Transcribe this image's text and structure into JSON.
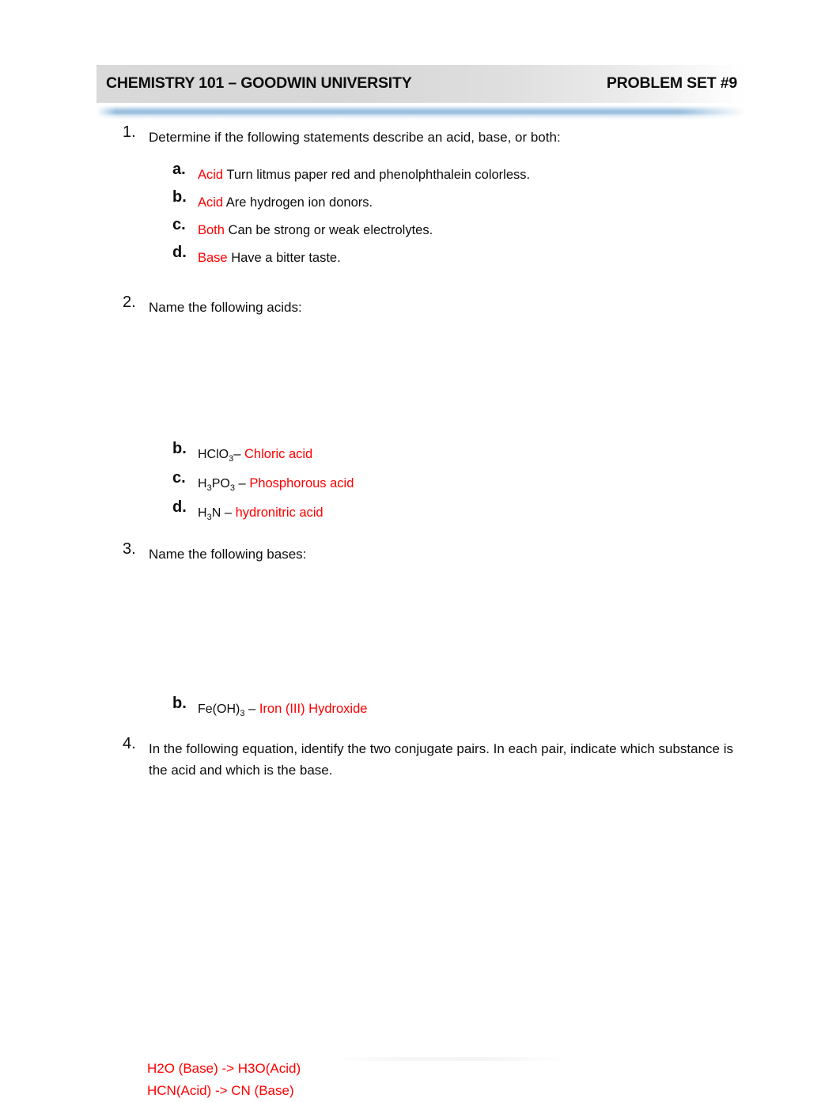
{
  "header": {
    "title_left": "CHEMISTRY 101 – GOODWIN UNIVERSITY",
    "title_right": "PROBLEM SET #9",
    "accent_color": "#9cc0de",
    "answer_color": "#ff0000"
  },
  "questions": [
    {
      "number": "1.",
      "prompt": "Determine if the following statements describe an acid, base, or both:",
      "items": [
        {
          "letter": "a.",
          "answer": "Acid",
          "text": "Turn litmus paper red and phenolphthalein colorless."
        },
        {
          "letter": "b.",
          "answer": "Acid",
          "text": "Are hydrogen ion donors."
        },
        {
          "letter": "c.",
          "answer": "Both",
          "text": "Can be strong or weak electrolytes."
        },
        {
          "letter": "d.",
          "answer": "Base",
          "text": "Have a bitter taste."
        }
      ]
    },
    {
      "number": "2.",
      "prompt": "Name the following acids:",
      "items": [
        {
          "letter": "b.",
          "formula_main": "HClO",
          "formula_sub": "3",
          "formula_tail": "",
          "dash": "–",
          "answer": "Chloric acid"
        },
        {
          "letter": "c.",
          "formula_main": "H",
          "formula_sub": "3",
          "formula_tail": "PO",
          "formula_sub2": "3",
          "dash": "–",
          "answer": "Phosphorous acid"
        },
        {
          "letter": "d.",
          "formula_main": "H",
          "formula_sub": "3",
          "formula_tail": "N",
          "dash": "–",
          "answer": "hydronitric acid"
        }
      ]
    },
    {
      "number": "3.",
      "prompt": "Name the following bases:",
      "items": [
        {
          "letter": "b.",
          "formula_main": "Fe(OH)",
          "formula_sub": "3",
          "formula_tail": "",
          "dash": "–",
          "answer": "Iron (III) Hydroxide"
        }
      ]
    },
    {
      "number": "4.",
      "prompt": "In the following equation, identify the two conjugate pairs.  In each pair, indicate which substance is the acid and which is the base.",
      "items": []
    }
  ],
  "bottom_answers": [
    "H2O (Base) -> H3O(Acid)",
    "HCN(Acid) -> CN (Base)"
  ]
}
